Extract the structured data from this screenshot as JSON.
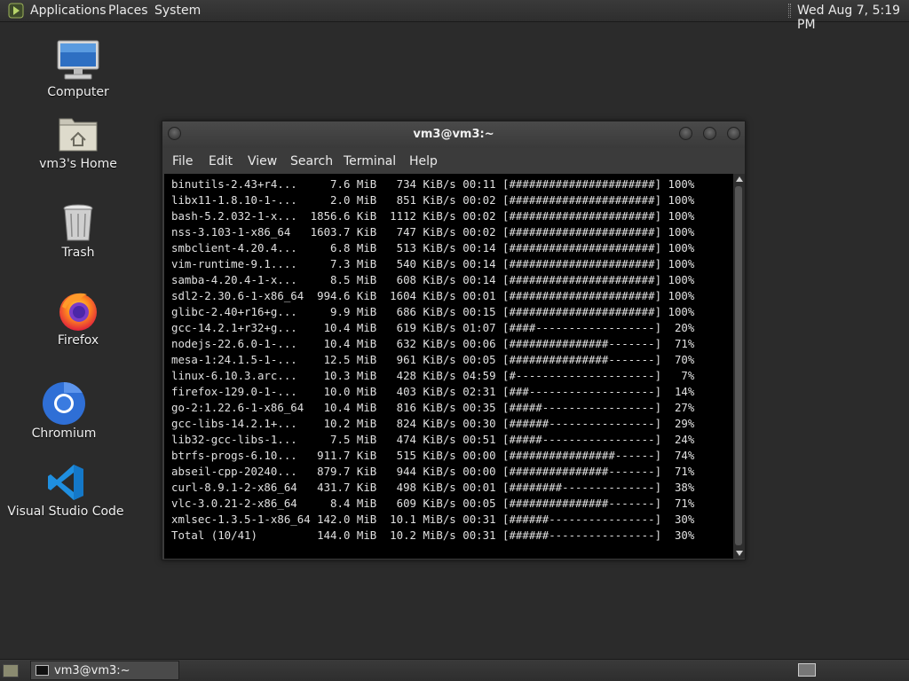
{
  "top_panel": {
    "menus": [
      "Applications",
      "Places",
      "System"
    ],
    "clock": "Wed Aug  7, 5:19 PM"
  },
  "desktop_icons": [
    {
      "label": "Computer",
      "icon": "computer-icon"
    },
    {
      "label": "vm3's Home",
      "icon": "home-folder-icon"
    },
    {
      "label": "Trash",
      "icon": "trash-icon"
    },
    {
      "label": "Firefox",
      "icon": "firefox-icon"
    },
    {
      "label": "Chromium",
      "icon": "chromium-icon"
    },
    {
      "label": "Visual Studio Code",
      "icon": "vscode-icon"
    }
  ],
  "terminal": {
    "title": "vm3@vm3:~",
    "menu": [
      "File",
      "Edit",
      "View",
      "Search",
      "Terminal",
      "Help"
    ],
    "lines": [
      "binutils-2.43+r4...     7.6 MiB   734 KiB/s 00:11 [######################] 100%",
      "libx11-1.8.10-1-...     2.0 MiB   851 KiB/s 00:02 [######################] 100%",
      "bash-5.2.032-1-x...  1856.6 KiB  1112 KiB/s 00:02 [######################] 100%",
      "nss-3.103-1-x86_64   1603.7 KiB   747 KiB/s 00:02 [######################] 100%",
      "smbclient-4.20.4...     6.8 MiB   513 KiB/s 00:14 [######################] 100%",
      "vim-runtime-9.1....     7.3 MiB   540 KiB/s 00:14 [######################] 100%",
      "samba-4.20.4-1-x...     8.5 MiB   608 KiB/s 00:14 [######################] 100%",
      "sdl2-2.30.6-1-x86_64  994.6 KiB  1604 KiB/s 00:01 [######################] 100%",
      "glibc-2.40+r16+g...     9.9 MiB   686 KiB/s 00:15 [######################] 100%",
      "gcc-14.2.1+r32+g...    10.4 MiB   619 KiB/s 01:07 [####------------------]  20%",
      "nodejs-22.6.0-1-...    10.4 MiB   632 KiB/s 00:06 [###############-------]  71%",
      "mesa-1:24.1.5-1-...    12.5 MiB   961 KiB/s 00:05 [###############-------]  70%",
      "linux-6.10.3.arc...    10.3 MiB   428 KiB/s 04:59 [#---------------------]   7%",
      "firefox-129.0-1-...    10.0 MiB   403 KiB/s 02:31 [###-------------------]  14%",
      "go-2:1.22.6-1-x86_64   10.4 MiB   816 KiB/s 00:35 [#####-----------------]  27%",
      "gcc-libs-14.2.1+...    10.2 MiB   824 KiB/s 00:30 [######----------------]  29%",
      "lib32-gcc-libs-1...     7.5 MiB   474 KiB/s 00:51 [#####-----------------]  24%",
      "btrfs-progs-6.10...   911.7 KiB   515 KiB/s 00:00 [################------]  74%",
      "abseil-cpp-20240...   879.7 KiB   944 KiB/s 00:00 [###############-------]  71%",
      "curl-8.9.1-2-x86_64   431.7 KiB   498 KiB/s 00:01 [########--------------]  38%",
      "vlc-3.0.21-2-x86_64     8.4 MiB   609 KiB/s 00:05 [###############-------]  71%",
      "xmlsec-1.3.5-1-x86_64 142.0 MiB  10.1 MiB/s 00:31 [######----------------]  30%",
      "Total (10/41)         144.0 MiB  10.2 MiB/s 00:31 [######----------------]  30%"
    ]
  },
  "taskbar": {
    "window_label": "vm3@vm3:~"
  }
}
